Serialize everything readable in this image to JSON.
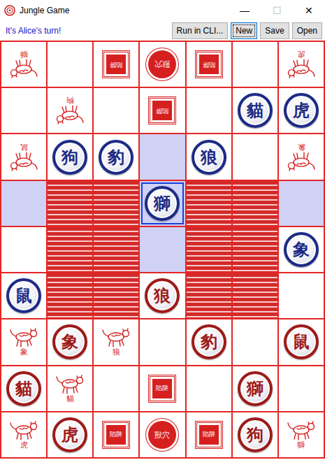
{
  "window": {
    "title": "Jungle Game",
    "controls": [
      {
        "text": "—",
        "disabled": false
      },
      {
        "text": "☐",
        "disabled": true
      },
      {
        "text": "✕",
        "disabled": false
      }
    ]
  },
  "status": "It's Alice's turn!",
  "buttons": [
    {
      "label": "Run in CLI...",
      "focused": false
    },
    {
      "label": "New",
      "focused": true
    },
    {
      "label": "Save",
      "focused": false
    },
    {
      "label": "Open",
      "focused": false
    }
  ],
  "board": {
    "rows": [
      [
        {
          "kind": "print",
          "label": "獅",
          "flipped": true,
          "highlighted": false
        },
        {
          "kind": "land",
          "highlighted": false
        },
        {
          "kind": "trap",
          "label": "陷阱",
          "flipped": true,
          "highlighted": false
        },
        {
          "kind": "den",
          "label": "獸穴",
          "flipped": true,
          "highlighted": false
        },
        {
          "kind": "trap",
          "label": "陷阱",
          "flipped": true,
          "highlighted": false
        },
        {
          "kind": "land",
          "highlighted": false
        },
        {
          "kind": "print",
          "label": "虎",
          "flipped": true,
          "highlighted": false
        }
      ],
      [
        {
          "kind": "land",
          "highlighted": false
        },
        {
          "kind": "print",
          "label": "狗",
          "flipped": true,
          "highlighted": false
        },
        {
          "kind": "land",
          "highlighted": false
        },
        {
          "kind": "trap",
          "label": "陷阱",
          "flipped": true,
          "highlighted": false
        },
        {
          "kind": "land",
          "highlighted": false
        },
        {
          "kind": "land",
          "highlighted": false,
          "piece": {
            "text": "貓",
            "color": "#1c2b86",
            "selected": false
          }
        },
        {
          "kind": "land",
          "highlighted": false,
          "piece": {
            "text": "虎",
            "color": "#1c2b86",
            "selected": false
          }
        }
      ],
      [
        {
          "kind": "print",
          "label": "鼠",
          "flipped": true,
          "highlighted": false
        },
        {
          "kind": "land",
          "highlighted": false,
          "piece": {
            "text": "狗",
            "color": "#1c2b86",
            "selected": false
          }
        },
        {
          "kind": "land",
          "highlighted": false,
          "piece": {
            "text": "豹",
            "color": "#1c2b86",
            "selected": false
          }
        },
        {
          "kind": "land",
          "highlighted": true
        },
        {
          "kind": "land",
          "highlighted": false,
          "piece": {
            "text": "狼",
            "color": "#1c2b86",
            "selected": false
          }
        },
        {
          "kind": "land",
          "highlighted": false
        },
        {
          "kind": "print",
          "label": "象",
          "flipped": true,
          "highlighted": false
        }
      ],
      [
        {
          "kind": "land",
          "highlighted": true
        },
        {
          "kind": "water",
          "highlighted": false
        },
        {
          "kind": "water",
          "highlighted": false
        },
        {
          "kind": "land",
          "highlighted": true,
          "piece": {
            "text": "獅",
            "color": "#1c2b86",
            "selected": true
          }
        },
        {
          "kind": "water",
          "highlighted": false
        },
        {
          "kind": "water",
          "highlighted": false
        },
        {
          "kind": "land",
          "highlighted": true
        }
      ],
      [
        {
          "kind": "land",
          "highlighted": false
        },
        {
          "kind": "water",
          "highlighted": false
        },
        {
          "kind": "water",
          "highlighted": false
        },
        {
          "kind": "land",
          "highlighted": true
        },
        {
          "kind": "water",
          "highlighted": false
        },
        {
          "kind": "water",
          "highlighted": false
        },
        {
          "kind": "land",
          "highlighted": false,
          "piece": {
            "text": "象",
            "color": "#1c2b86",
            "selected": false
          }
        }
      ],
      [
        {
          "kind": "land",
          "highlighted": false,
          "piece": {
            "text": "鼠",
            "color": "#1c2b86",
            "selected": false
          }
        },
        {
          "kind": "water",
          "highlighted": false
        },
        {
          "kind": "water",
          "highlighted": false
        },
        {
          "kind": "land",
          "highlighted": false,
          "piece": {
            "text": "狼",
            "color": "#9e1a1a",
            "selected": false
          }
        },
        {
          "kind": "water",
          "highlighted": false
        },
        {
          "kind": "water",
          "highlighted": false
        },
        {
          "kind": "land",
          "highlighted": false
        }
      ],
      [
        {
          "kind": "print",
          "label": "象",
          "flipped": false,
          "highlighted": false
        },
        {
          "kind": "land",
          "highlighted": false,
          "piece": {
            "text": "象",
            "color": "#9e1a1a",
            "selected": false
          }
        },
        {
          "kind": "print",
          "label": "狼",
          "flipped": false,
          "highlighted": false
        },
        {
          "kind": "land",
          "highlighted": false
        },
        {
          "kind": "land",
          "highlighted": false,
          "piece": {
            "text": "豹",
            "color": "#9e1a1a",
            "selected": false
          }
        },
        {
          "kind": "land",
          "highlighted": false
        },
        {
          "kind": "land",
          "highlighted": false,
          "piece": {
            "text": "鼠",
            "color": "#9e1a1a",
            "selected": false
          }
        }
      ],
      [
        {
          "kind": "land",
          "highlighted": false,
          "piece": {
            "text": "貓",
            "color": "#9e1a1a",
            "selected": false
          }
        },
        {
          "kind": "print",
          "label": "貓",
          "flipped": false,
          "highlighted": false
        },
        {
          "kind": "land",
          "highlighted": false
        },
        {
          "kind": "trap",
          "label": "陷阱",
          "flipped": false,
          "highlighted": false
        },
        {
          "kind": "land",
          "highlighted": false
        },
        {
          "kind": "land",
          "highlighted": false,
          "piece": {
            "text": "獅",
            "color": "#9e1a1a",
            "selected": false
          }
        },
        {
          "kind": "land",
          "highlighted": false
        }
      ],
      [
        {
          "kind": "print",
          "label": "虎",
          "flipped": false,
          "highlighted": false
        },
        {
          "kind": "land",
          "highlighted": false,
          "piece": {
            "text": "虎",
            "color": "#9e1a1a",
            "selected": false
          }
        },
        {
          "kind": "trap",
          "label": "陷阱",
          "flipped": false,
          "highlighted": false
        },
        {
          "kind": "den",
          "label": "獸穴",
          "flipped": false,
          "highlighted": false
        },
        {
          "kind": "trap",
          "label": "陷阱",
          "flipped": false,
          "highlighted": false
        },
        {
          "kind": "land",
          "highlighted": false,
          "piece": {
            "text": "狗",
            "color": "#9e1a1a",
            "selected": false
          }
        },
        {
          "kind": "print",
          "label": "獅",
          "flipped": false,
          "highlighted": false
        }
      ]
    ]
  }
}
